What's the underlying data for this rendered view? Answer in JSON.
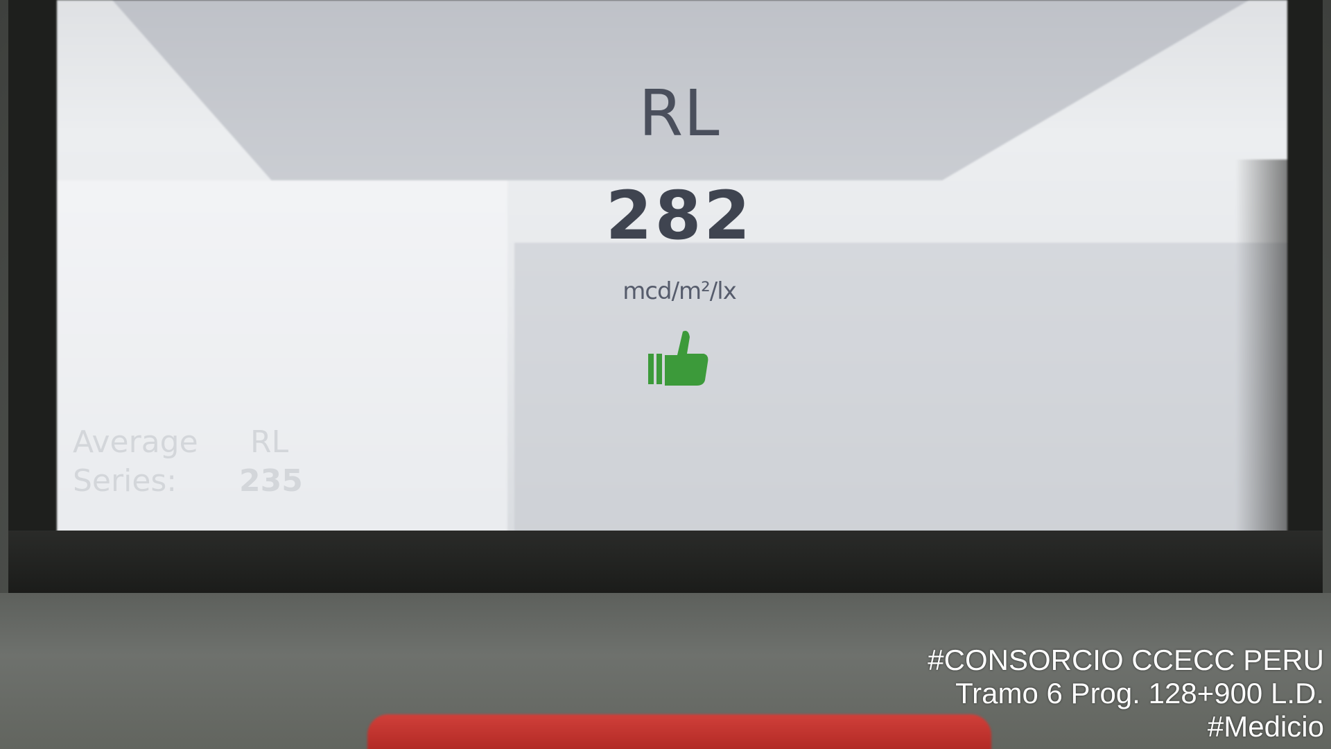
{
  "display": {
    "measurement_label": "RL",
    "measurement_value": "282",
    "unit": "mcd/m²/lx",
    "result_icon": "thumbs-up-icon",
    "result_color": "#3c9a3a"
  },
  "average": {
    "label_line1": "Average",
    "label_line2": "Series:",
    "key": "RL",
    "value": "235"
  },
  "watermark": {
    "line1": "#CONSORCIO CCECC PERU",
    "line2": "Tramo 6 Prog. 128+900 L.D.",
    "line3": "#Medicio"
  }
}
